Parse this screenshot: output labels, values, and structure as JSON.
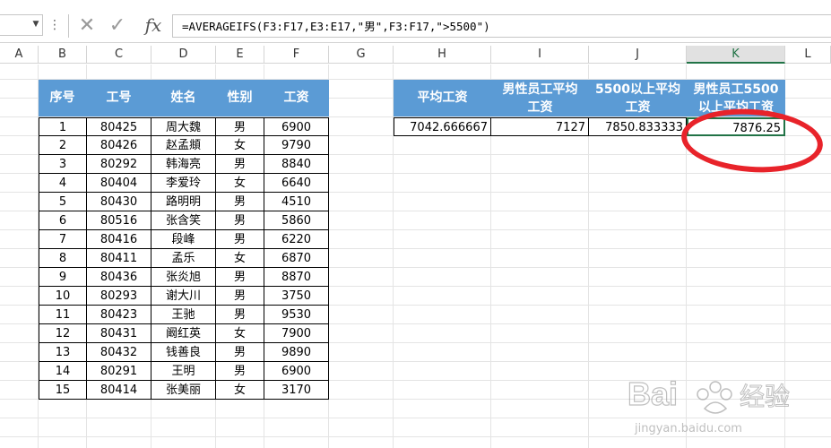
{
  "formula_bar": {
    "name_box": "",
    "cancel_icon": "✕",
    "enter_icon": "✓",
    "fx_label": "fx",
    "formula": "=AVERAGEIFS(F3:F17,E3:E17,\"男\",F3:F17,\">5500\")"
  },
  "columns": [
    "A",
    "B",
    "C",
    "D",
    "E",
    "F",
    "G",
    "H",
    "I",
    "J",
    "K",
    "L"
  ],
  "active_column": "K",
  "employee_table": {
    "headers": [
      "序号",
      "工号",
      "姓名",
      "性别",
      "工资"
    ],
    "rows": [
      [
        "1",
        "80425",
        "周大魏",
        "男",
        "6900"
      ],
      [
        "2",
        "80426",
        "赵孟頫",
        "女",
        "9790"
      ],
      [
        "3",
        "80292",
        "韩海亮",
        "男",
        "8840"
      ],
      [
        "4",
        "80404",
        "李爱玲",
        "女",
        "6640"
      ],
      [
        "5",
        "80430",
        "路明明",
        "男",
        "4510"
      ],
      [
        "6",
        "80516",
        "张含笑",
        "男",
        "5860"
      ],
      [
        "7",
        "80416",
        "段峰",
        "男",
        "6220"
      ],
      [
        "8",
        "80411",
        "孟乐",
        "女",
        "6870"
      ],
      [
        "9",
        "80436",
        "张炎旭",
        "男",
        "8870"
      ],
      [
        "10",
        "80293",
        "谢大川",
        "男",
        "3750"
      ],
      [
        "11",
        "80423",
        "王驰",
        "男",
        "9530"
      ],
      [
        "12",
        "80431",
        "阚红英",
        "女",
        "7900"
      ],
      [
        "13",
        "80432",
        "钱善良",
        "男",
        "9890"
      ],
      [
        "14",
        "80291",
        "王明",
        "男",
        "6900"
      ],
      [
        "15",
        "80414",
        "张美丽",
        "女",
        "3170"
      ]
    ]
  },
  "summary_table": {
    "headers": [
      "平均工资",
      "男性员工平均\n工资",
      "5500以上平均\n工资",
      "男性员工5500\n以上平均工资"
    ],
    "values": [
      "7042.666667",
      "7127",
      "7850.833333",
      "7876.25"
    ]
  },
  "watermark": {
    "brand": "Bai",
    "brand2": "经验",
    "url": "jingyan.baidu.com"
  },
  "colors": {
    "header_bg": "#5b9bd5",
    "annotation_circle": "#e8232a",
    "active_col": "#217346"
  }
}
